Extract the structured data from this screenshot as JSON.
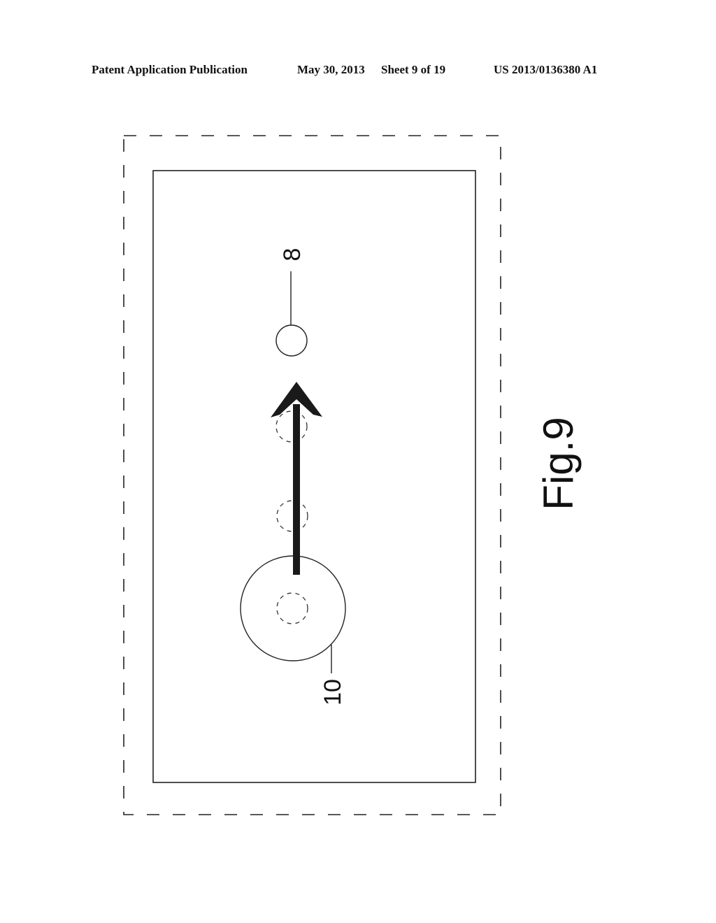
{
  "header": {
    "publication_label": "Patent Application Publication",
    "date": "May 30, 2013",
    "sheet": "Sheet 9 of 19",
    "patent_number": "US 2013/0136380 A1"
  },
  "figure": {
    "caption": "Fig.9",
    "reference_labels": {
      "small_target": "8",
      "large_object": "10"
    },
    "elements": [
      {
        "id": "outer-boundary",
        "style": "dashed rectangle"
      },
      {
        "id": "inner-frame",
        "style": "solid rectangle"
      },
      {
        "id": "target-circle",
        "ref": "8",
        "style": "solid small circle"
      },
      {
        "id": "large-circle",
        "ref": "10",
        "style": "solid large circle"
      },
      {
        "id": "ghost-positions",
        "count": 3,
        "style": "dashed small circles"
      },
      {
        "id": "movement-arrow",
        "direction": "up",
        "style": "thick filled arrow"
      }
    ],
    "colors": {
      "ink": "#111111",
      "background": "#ffffff"
    }
  }
}
